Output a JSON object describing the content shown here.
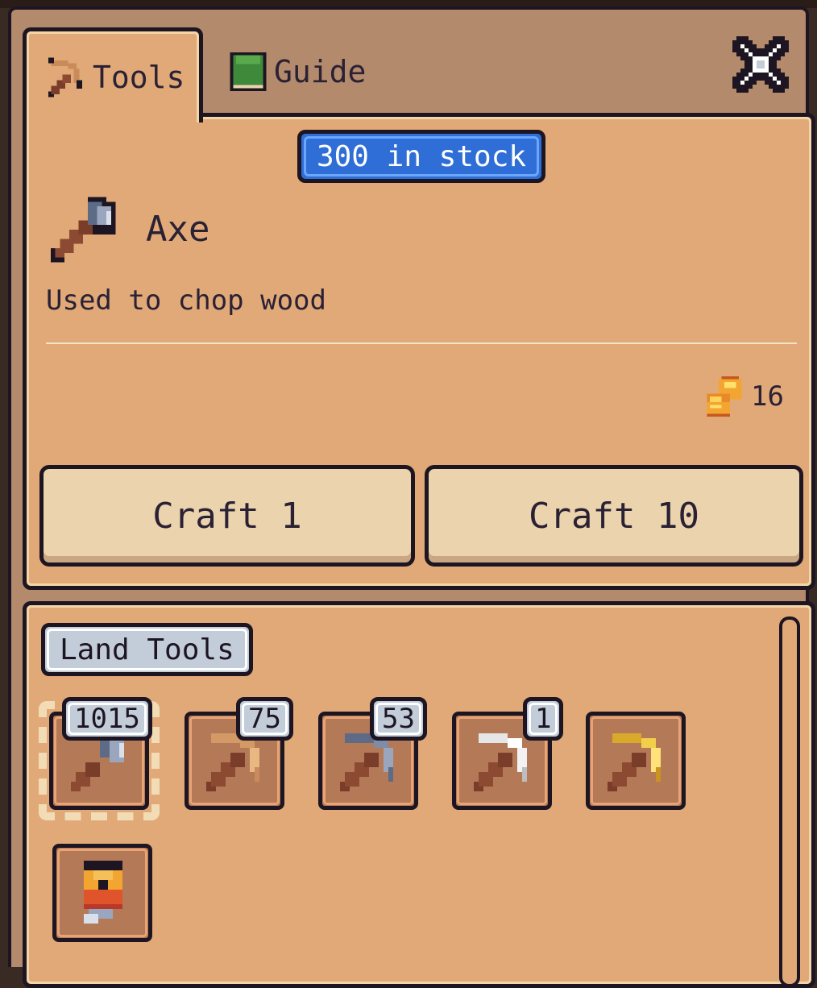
{
  "tabs": [
    {
      "label": "Tools",
      "icon": "pickaxe-icon",
      "active": true
    },
    {
      "label": "Guide",
      "icon": "book-icon",
      "active": false
    }
  ],
  "close_icon": "close-icon",
  "selected_item": {
    "stock_label": "300 in stock",
    "name": "Axe",
    "icon": "axe-icon",
    "description": "Used to chop wood",
    "price": "16",
    "price_icon": "coins-icon"
  },
  "buttons": {
    "craft_one": "Craft 1",
    "craft_ten": "Craft 10"
  },
  "inventory": {
    "section_label": "Land Tools",
    "items": [
      {
        "name": "axe",
        "icon": "axe-icon",
        "count": "1015",
        "selected": true
      },
      {
        "name": "wood-pickaxe",
        "icon": "wood-pickaxe-icon",
        "count": "75"
      },
      {
        "name": "stone-pickaxe",
        "icon": "stone-pickaxe-icon",
        "count": "53"
      },
      {
        "name": "iron-pickaxe",
        "icon": "iron-pickaxe-icon",
        "count": "1"
      },
      {
        "name": "gold-pickaxe",
        "icon": "gold-pickaxe-icon",
        "count": ""
      },
      {
        "name": "rod",
        "icon": "rod-icon",
        "count": ""
      }
    ]
  },
  "colors": {
    "panel": "#e0a977",
    "window": "#b48a6c",
    "outline": "#1d1622",
    "stock_badge": "#2f6ed6",
    "button": "#ead3ad",
    "count_badge": "#c3ccd9"
  }
}
